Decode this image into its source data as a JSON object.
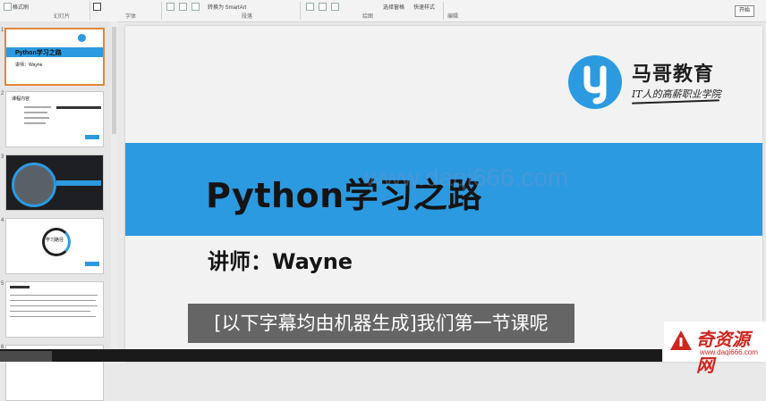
{
  "ribbon": {
    "texts": [
      "格式刷",
      "幻灯片",
      "字体",
      "段落",
      "转换为 SmartArt",
      "绘图",
      "选择窗格",
      "快速样式",
      "编辑"
    ],
    "save_label": "开始"
  },
  "thumbnails": [
    {
      "num": "1",
      "title": "Python学习之路",
      "sub": "讲师：Wayne"
    },
    {
      "num": "2",
      "title": "课程内容"
    },
    {
      "num": "3",
      "title": ""
    },
    {
      "num": "4",
      "title": "学习路径"
    },
    {
      "num": "5",
      "title": ""
    },
    {
      "num": "6",
      "title": ""
    }
  ],
  "slide": {
    "brand_name": "马哥教育",
    "brand_tagline": "IT人的高薪职业学院",
    "title": "Python学习之路",
    "lecturer": "讲师：Wayne",
    "watermark": "www.daqi666.com",
    "colors": {
      "banner": "#2c9ae0",
      "logo": "#2c9ae0"
    }
  },
  "subtitle": "[以下字幕均由机器生成]我们第一节课呢",
  "site_logo": {
    "name": "奇资源网",
    "url": "www.daqi666.com"
  }
}
